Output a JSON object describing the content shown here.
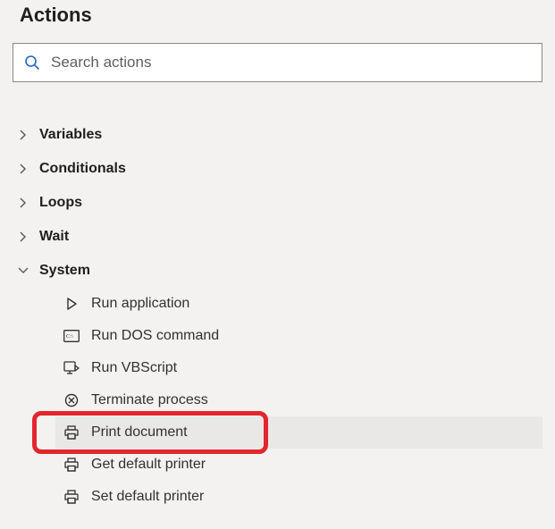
{
  "panel": {
    "title": "Actions"
  },
  "search": {
    "placeholder": "Search actions"
  },
  "tree": {
    "groups": [
      {
        "label": "Variables",
        "expanded": false
      },
      {
        "label": "Conditionals",
        "expanded": false
      },
      {
        "label": "Loops",
        "expanded": false
      },
      {
        "label": "Wait",
        "expanded": false
      },
      {
        "label": "System",
        "expanded": true
      }
    ],
    "system_actions": [
      {
        "icon": "play",
        "label": "Run application"
      },
      {
        "icon": "dos",
        "label": "Run DOS command"
      },
      {
        "icon": "vbscript",
        "label": "Run VBScript"
      },
      {
        "icon": "terminate",
        "label": "Terminate process"
      },
      {
        "icon": "print",
        "label": "Print document",
        "highlighted": true
      },
      {
        "icon": "print",
        "label": "Get default printer"
      },
      {
        "icon": "print",
        "label": "Set default printer"
      }
    ]
  },
  "colors": {
    "highlight": "#e3262d",
    "search_icon": "#2266c2"
  }
}
